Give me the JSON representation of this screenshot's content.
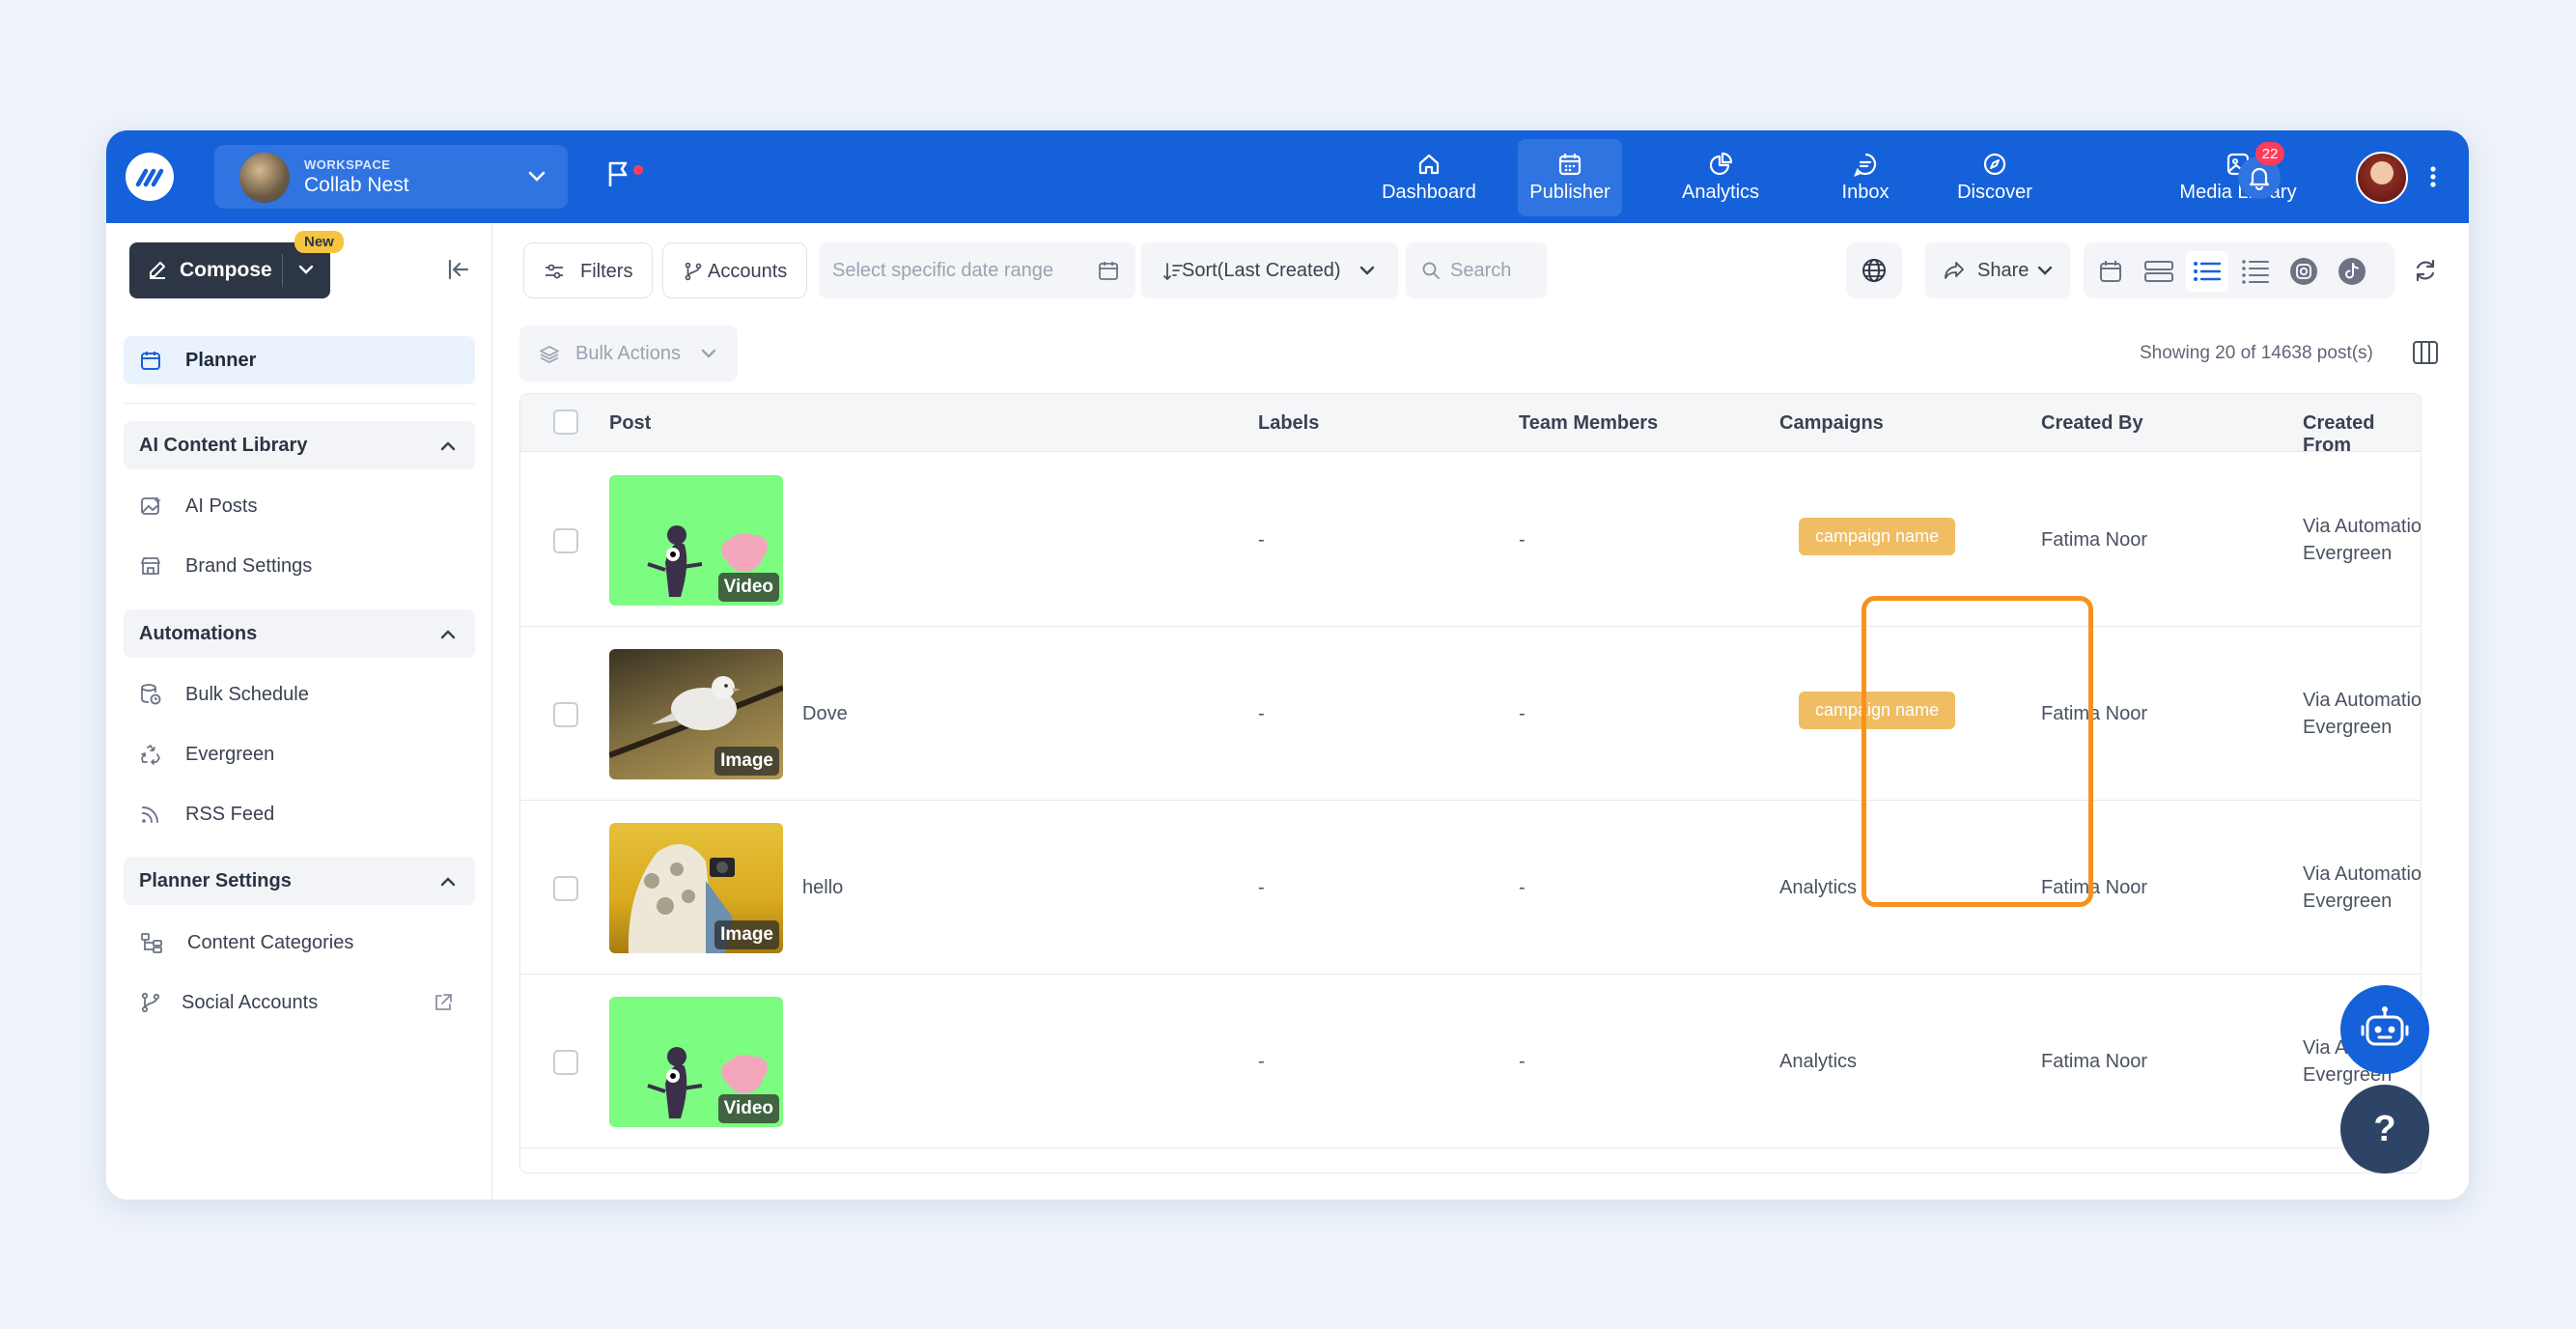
{
  "workspace": {
    "tag": "WORKSPACE",
    "name": "Collab Nest"
  },
  "nav": [
    {
      "label": "Dashboard",
      "icon": "home-icon"
    },
    {
      "label": "Publisher",
      "icon": "calendar-icon",
      "active": true
    },
    {
      "label": "Analytics",
      "icon": "pie-chart-icon"
    },
    {
      "label": "Inbox",
      "icon": "chat-icon"
    },
    {
      "label": "Discover",
      "icon": "compass-icon"
    },
    {
      "label": "Media Library",
      "icon": "image-icon"
    }
  ],
  "notifications": {
    "count": "22"
  },
  "sidebar": {
    "compose_label": "Compose",
    "new_badge": "New",
    "planner": "Planner",
    "sections": [
      {
        "title": "AI Content Library",
        "items": [
          "AI Posts",
          "Brand Settings"
        ]
      },
      {
        "title": "Automations",
        "items": [
          "Bulk Schedule",
          "Evergreen",
          "RSS Feed"
        ]
      },
      {
        "title": "Planner Settings",
        "items": [
          "Content Categories",
          "Social Accounts"
        ]
      }
    ]
  },
  "toolbar": {
    "filters": "Filters",
    "accounts": "Accounts",
    "date_placeholder": "Select specific date range",
    "sort": "Sort(Last Created)",
    "search_placeholder": "Search",
    "share": "Share",
    "bulk_actions": "Bulk Actions",
    "showing": "Showing 20 of 14638 post(s)"
  },
  "table": {
    "columns": [
      "Post",
      "Labels",
      "Team Members",
      "Campaigns",
      "Created By",
      "Created From"
    ],
    "rows": [
      {
        "type": "Video",
        "title": "",
        "labels": "-",
        "team": "-",
        "campaign": "campaign name",
        "campaign_badge": true,
        "created_by": "Fatima Noor",
        "from1": "Via Automation",
        "from2": "Evergreen"
      },
      {
        "type": "Image",
        "title": "Dove",
        "labels": "-",
        "team": "-",
        "campaign": "campaign name",
        "campaign_badge": true,
        "created_by": "Fatima Noor",
        "from1": "Via Automation",
        "from2": "Evergreen"
      },
      {
        "type": "Image",
        "title": "hello",
        "labels": "-",
        "team": "-",
        "campaign": "Analytics",
        "campaign_badge": false,
        "created_by": "Fatima Noor",
        "from1": "Via Automation",
        "from2": "Evergreen"
      },
      {
        "type": "Video",
        "title": "",
        "labels": "-",
        "team": "-",
        "campaign": "Analytics",
        "campaign_badge": false,
        "created_by": "Fatima Noor",
        "from1": "Via A",
        "from2": "Evergreen"
      }
    ]
  },
  "help_label": "?",
  "colors": {
    "brand": "#1561d9",
    "highlight": "#f7921e",
    "campaign_badge": "#f0bd63"
  }
}
